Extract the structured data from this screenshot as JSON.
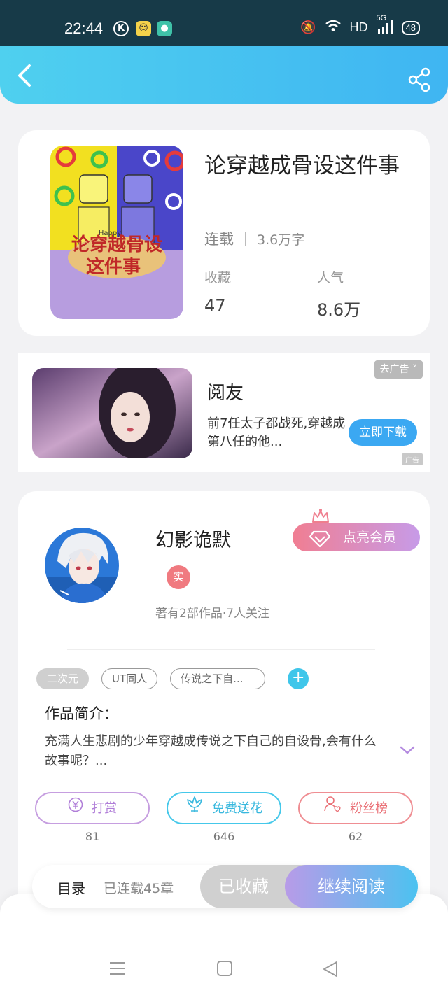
{
  "status_bar": {
    "time": "22:44",
    "app_icons": [
      "k-icon",
      "wechat-notify-icon",
      "chat-notify-icon"
    ],
    "network": "HD",
    "signal": "5G",
    "battery": "48"
  },
  "header": {
    "back_icon": "back-arrow-icon",
    "share_icon": "share-icon",
    "gradient": [
      "#4fd0ef",
      "#3fb5f2"
    ]
  },
  "book": {
    "title": "论穿越成骨设这件事",
    "status": "连载",
    "word_count": "3.6万字",
    "favorites_label": "收藏",
    "favorites_value": "47",
    "popularity_label": "人气",
    "popularity_value": "8.6万",
    "cover_text": "论穿越成骨设这件事",
    "cover_badge": "Happy"
  },
  "ad": {
    "title": "阅友",
    "description": "前7任太子都战死,穿越成第八任的他...",
    "cta": "立即下载",
    "close_label": "去广告",
    "ad_mark": "广告"
  },
  "author": {
    "name": "幻影诡默",
    "vip_label": "点亮会员",
    "real_badge": "实",
    "stats": "著有2部作品·7人关注"
  },
  "tags": [
    "二次元",
    "UT同人",
    "传说之下自..."
  ],
  "intro": {
    "title": "作品简介：",
    "text": "充满人生悲剧的少年穿越成传说之下自己的自设骨,会有什么故事呢？..."
  },
  "actions": [
    {
      "label": "打赏",
      "count": "81",
      "icon": "yen-coin-icon"
    },
    {
      "label": "免费送花",
      "count": "646",
      "icon": "flower-icon"
    },
    {
      "label": "粉丝榜",
      "count": "62",
      "icon": "fan-ranking-icon"
    }
  ],
  "reader_bar": {
    "toc": "目录",
    "chapters": "已连载45章",
    "collected": "已收藏",
    "continue": "继续阅读"
  },
  "nav": {
    "icons": [
      "menu-icon",
      "home-square-icon",
      "back-triangle-icon"
    ]
  },
  "colors": {
    "accent_blue": "#3fb5f2",
    "vip_pink": "#f07e92",
    "vip_purple": "#c79be8"
  }
}
